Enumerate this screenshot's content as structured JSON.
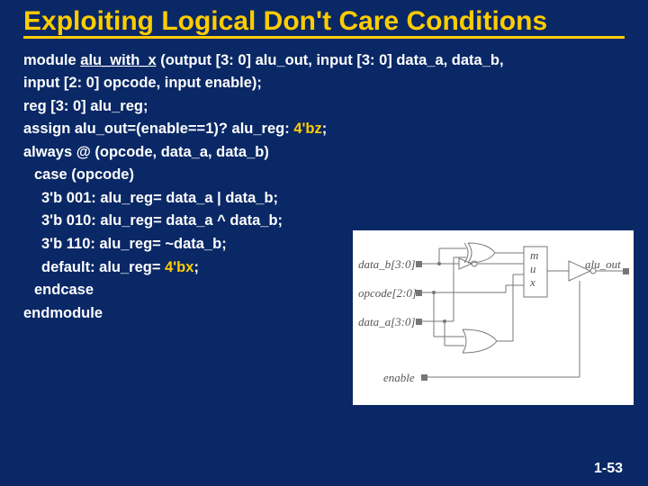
{
  "title": "Exploiting Logical Don't Care Conditions",
  "code": {
    "l1a": "module ",
    "l1b": "alu_with_x",
    "l1c": " (output [3: 0] alu_out, input [3: 0] data_a, data_b,",
    "l2": "input [2: 0] opcode, input enable);",
    "l3": "reg [3: 0] alu_reg;",
    "l4a": "assign alu_out=(enable==1)? alu_reg: ",
    "l4b": "4'bz",
    "l4c": ";",
    "l5": "always @ (opcode, data_a, data_b)",
    "l6": "case (opcode)",
    "l7": "3'b 001: alu_reg= data_a | data_b;",
    "l8": "3'b 010: alu_reg= data_a ^ data_b;",
    "l9": "3'b 110: alu_reg= ~data_b;",
    "l10a": "default: alu_reg= ",
    "l10b": "4'bx",
    "l10c": ";",
    "l11": "endcase",
    "l12": "endmodule"
  },
  "diagram": {
    "data_b": "data_b[3:0]",
    "opcode": "opcode[2:0]",
    "data_a": "data_a[3:0]",
    "enable": "enable",
    "alu_out": "alu_out",
    "mux_m": "m",
    "mux_u": "u",
    "mux_x": "x"
  },
  "page": "1-53"
}
